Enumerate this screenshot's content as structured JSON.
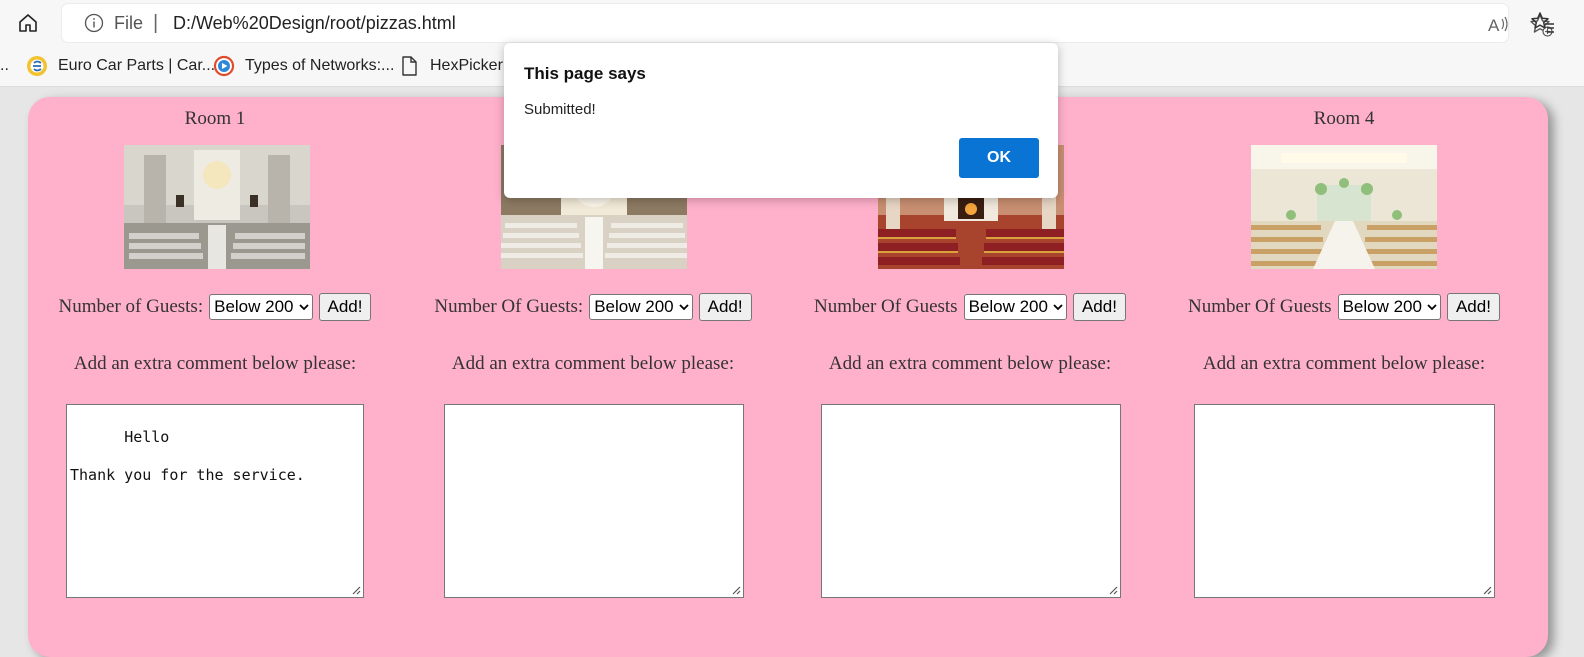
{
  "browser": {
    "file_label": "File",
    "separator": "|",
    "url": "D:/Web%20Design/root/pizzas.html",
    "bookmarks": [
      {
        "label": "..",
        "icon": "ellipsis"
      },
      {
        "label": "Euro Car Parts | Car...",
        "icon": "eurocarparts-favicon"
      },
      {
        "label": "Types of Networks:...",
        "icon": "play-favicon"
      },
      {
        "label": "HexPicker |",
        "icon": "page-icon"
      }
    ]
  },
  "dialog": {
    "title": "This page says",
    "message": "Submitted!",
    "ok_label": "OK"
  },
  "rooms": [
    {
      "title": "Room 1",
      "guests_label": "Number of Guests:",
      "select_value": "Below 200",
      "add_label": "Add!",
      "comment_label": "Add an extra comment below please:",
      "comment": "Hello\n\nThank you for the service."
    },
    {
      "title": "",
      "guests_label": "Number Of Guests:",
      "select_value": "Below 200",
      "add_label": "Add!",
      "comment_label": "Add an extra comment below please:",
      "comment": ""
    },
    {
      "title": "",
      "guests_label": "Number Of Guests",
      "select_value": "Below 200",
      "add_label": "Add!",
      "comment_label": "Add an extra comment below please:",
      "comment": ""
    },
    {
      "title": "Room 4",
      "guests_label": "Number Of Guests",
      "select_value": "Below 200",
      "add_label": "Add!",
      "comment_label": "Add an extra comment below please:",
      "comment": ""
    }
  ],
  "colors": {
    "page_background": "#ffb0cb",
    "ok_button": "#0a74d4"
  }
}
